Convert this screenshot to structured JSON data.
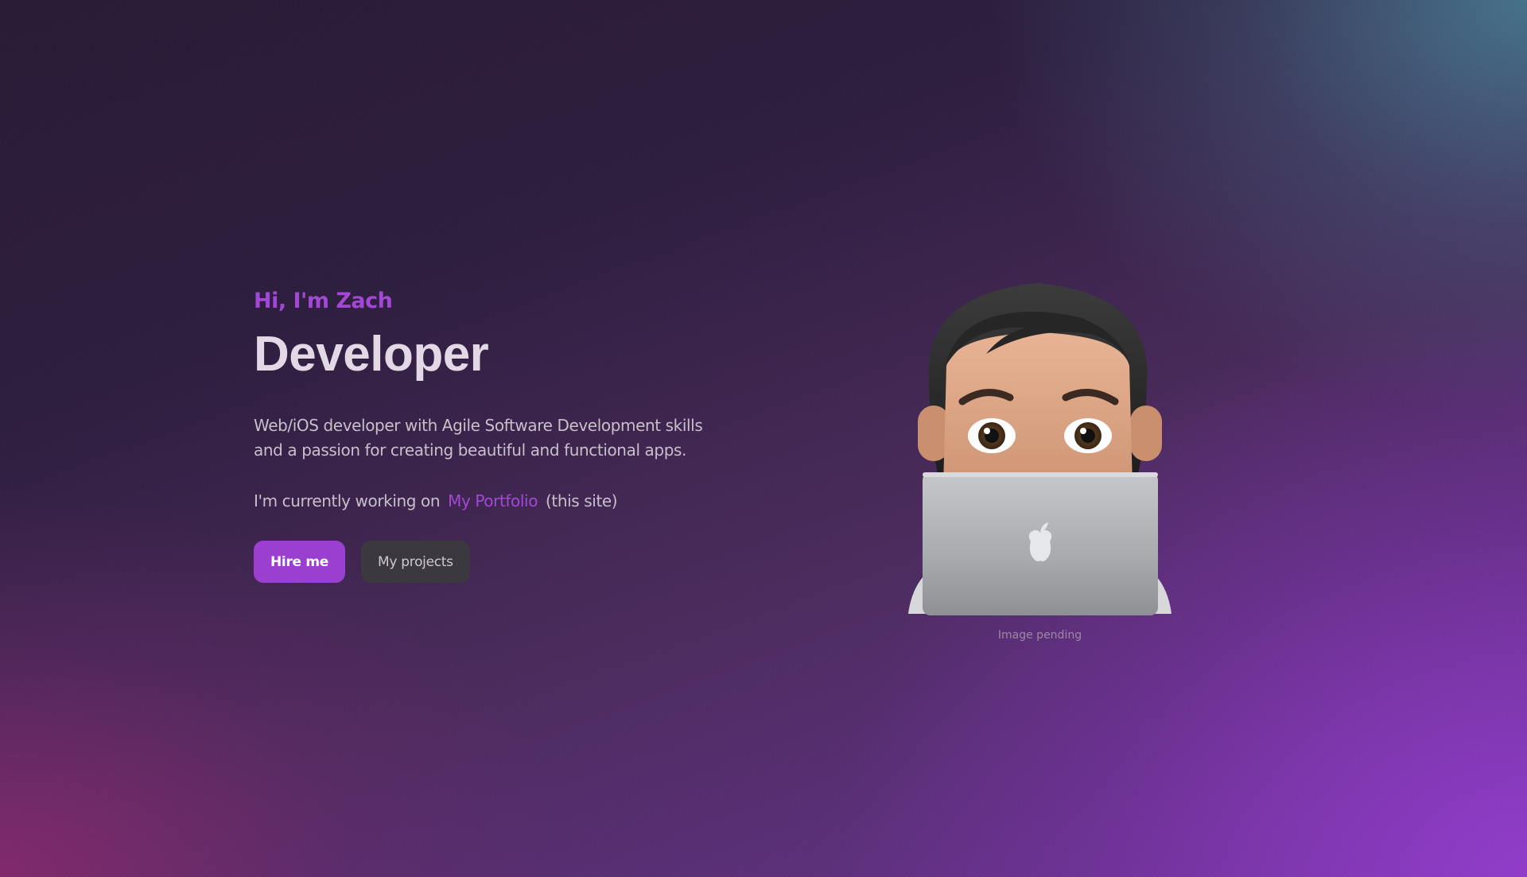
{
  "hero": {
    "greeting": "Hi, I'm Zach",
    "headline": "Developer",
    "bio": "Web/iOS developer with Agile Software Development skills and a passion for creating beautiful and functional apps.",
    "working_prefix": "I'm currently working on",
    "working_link": "My Portfolio",
    "working_suffix": "(this site)"
  },
  "buttons": {
    "hire": "Hire me",
    "projects": "My projects"
  },
  "avatar": {
    "icon": "memoji-avatar-icon",
    "laptop_icon": "apple-logo-icon",
    "caption": "Image pending"
  },
  "colors": {
    "accent": "#a348d6",
    "headline": "#e3d9e6",
    "body_text": "#c9bfcb",
    "primary_button": "#9a3fcf",
    "secondary_button": "#3c3a3e"
  }
}
